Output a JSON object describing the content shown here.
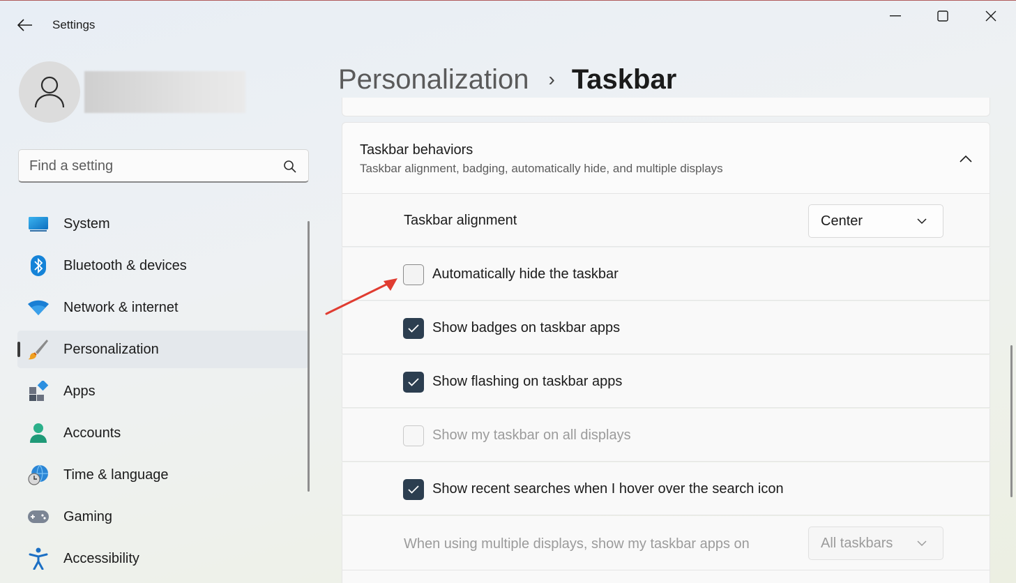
{
  "window": {
    "title": "Settings",
    "back_label": "Back",
    "controls": {
      "minimize": "Minimize",
      "maximize": "Maximize",
      "close": "Close"
    }
  },
  "sidebar": {
    "search": {
      "placeholder": "Find a setting",
      "value": ""
    },
    "items": [
      {
        "label": "System",
        "icon": "system-icon",
        "active": false
      },
      {
        "label": "Bluetooth & devices",
        "icon": "bluetooth-icon",
        "active": false
      },
      {
        "label": "Network & internet",
        "icon": "wifi-icon",
        "active": false
      },
      {
        "label": "Personalization",
        "icon": "paintbrush-icon",
        "active": true
      },
      {
        "label": "Apps",
        "icon": "apps-icon",
        "active": false
      },
      {
        "label": "Accounts",
        "icon": "accounts-icon",
        "active": false
      },
      {
        "label": "Time & language",
        "icon": "globe-clock-icon",
        "active": false
      },
      {
        "label": "Gaming",
        "icon": "gamepad-icon",
        "active": false
      },
      {
        "label": "Accessibility",
        "icon": "accessibility-icon",
        "active": false
      }
    ]
  },
  "breadcrumb": {
    "parent": "Personalization",
    "separator": "›",
    "current": "Taskbar"
  },
  "section": {
    "title": "Taskbar behaviors",
    "subtitle": "Taskbar alignment, badging, automatically hide, and multiple displays",
    "expanded": true,
    "alignment": {
      "label": "Taskbar alignment",
      "value": "Center"
    },
    "options": [
      {
        "label": "Automatically hide the taskbar",
        "checked": false,
        "disabled": false
      },
      {
        "label": "Show badges on taskbar apps",
        "checked": true,
        "disabled": false
      },
      {
        "label": "Show flashing on taskbar apps",
        "checked": true,
        "disabled": false
      },
      {
        "label": "Show my taskbar on all displays",
        "checked": false,
        "disabled": true
      },
      {
        "label": "Show recent searches when I hover over the search icon",
        "checked": true,
        "disabled": false
      }
    ],
    "multiple_displays": {
      "label": "When using multiple displays, show my taskbar apps on",
      "value": "All taskbars",
      "disabled": true
    }
  },
  "colors": {
    "accent_checkbox": "#2c3e50",
    "annotation_arrow": "#e03c31"
  }
}
